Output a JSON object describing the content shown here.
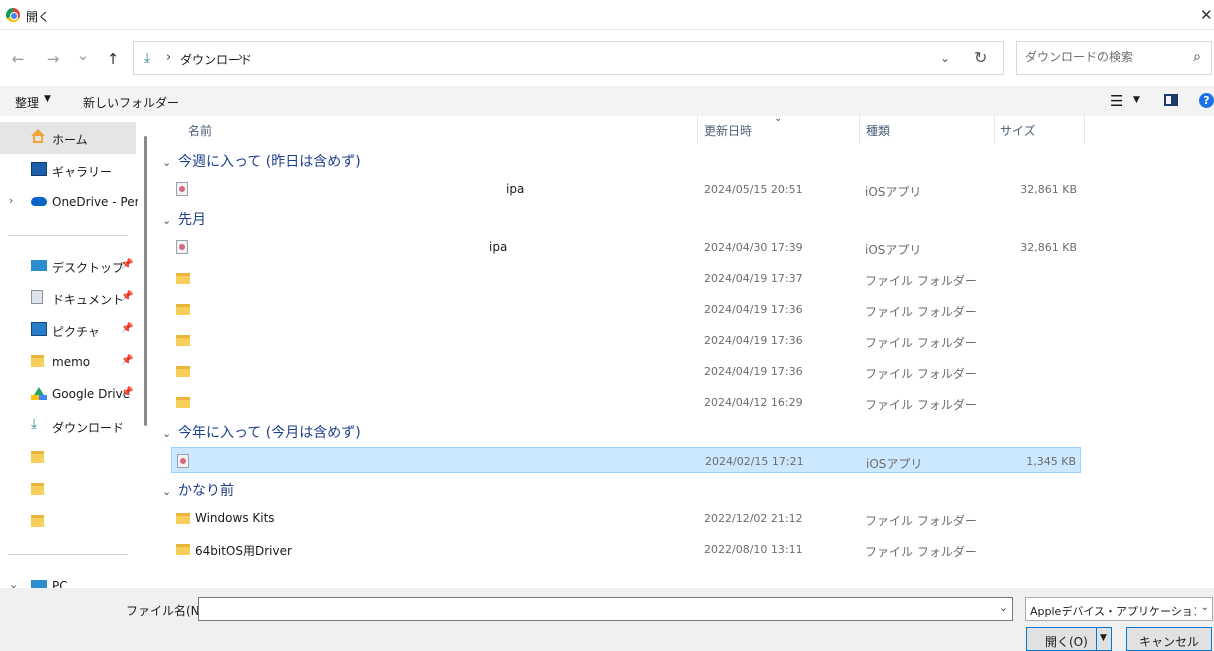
{
  "window": {
    "title": "開く",
    "close_glyph": "✕"
  },
  "nav": {
    "back_glyph": "←",
    "forward_glyph": "→",
    "recent_glyph": "⌄",
    "up_glyph": "↑",
    "address_icon": "download-icon",
    "address_crumb": "ダウンロード",
    "crumb_separator": "›",
    "address_dropdown_glyph": "⌄",
    "refresh_glyph": "↻",
    "search_placeholder": "ダウンロードの検索",
    "search_glyph": "⌕"
  },
  "toolbar": {
    "organize_label": "整理",
    "organize_caret": "▼",
    "new_folder_label": "新しいフォルダー",
    "view_glyph": "☰",
    "view_caret": "▼",
    "help_glyph": "?"
  },
  "sidebar": {
    "items": [
      {
        "label": "ホーム",
        "icon": "home-icon",
        "selected": true,
        "pinned": false,
        "chevron": ""
      },
      {
        "label": "ギャラリー",
        "icon": "gallery-icon",
        "pinned": false,
        "chevron": ""
      },
      {
        "label": "OneDrive - Personal",
        "icon": "onedrive-icon",
        "pinned": false,
        "chevron": "›"
      },
      {
        "label": "デスクトップ",
        "icon": "desktop-icon",
        "pinned": true
      },
      {
        "label": "ドキュメント",
        "icon": "document-icon",
        "pinned": true
      },
      {
        "label": "ピクチャ",
        "icon": "picture-icon",
        "pinned": true
      },
      {
        "label": "memo",
        "icon": "folder-icon",
        "pinned": true
      },
      {
        "label": "Google Drive",
        "icon": "google-drive-icon",
        "pinned": true
      },
      {
        "label": "ダウンロード",
        "icon": "download-icon",
        "pinned": false
      },
      {
        "label": "",
        "icon": "folder-icon"
      },
      {
        "label": "",
        "icon": "folder-icon"
      },
      {
        "label": "",
        "icon": "folder-icon"
      },
      {
        "label": "PC",
        "icon": "pc-icon",
        "chevron": "⌄"
      }
    ],
    "pin_glyph": "📌"
  },
  "columns": {
    "name": "名前",
    "date": "更新日時",
    "type": "種類",
    "size": "サイズ",
    "sort_glyph": "⌄"
  },
  "groups": [
    {
      "label": "今週に入って (昨日は含めず)",
      "chevron": "⌄"
    },
    {
      "label": "先月",
      "chevron": "⌄"
    },
    {
      "label": "今年に入って (今月は含めず)",
      "chevron": "⌄"
    },
    {
      "label": "かなり前",
      "chevron": "⌄"
    }
  ],
  "files": [
    {
      "name": "ipa",
      "date": "2024/05/15 20:51",
      "type": "iOSアプリ",
      "size": "32,861 KB",
      "kind": "file"
    },
    {
      "name": "ipa",
      "date": "2024/04/30 17:39",
      "type": "iOSアプリ",
      "size": "32,861 KB",
      "kind": "file"
    },
    {
      "name": "",
      "date": "2024/04/19 17:37",
      "type": "ファイル フォルダー",
      "size": "",
      "kind": "folder"
    },
    {
      "name": "",
      "date": "2024/04/19 17:36",
      "type": "ファイル フォルダー",
      "size": "",
      "kind": "folder"
    },
    {
      "name": "",
      "date": "2024/04/19 17:36",
      "type": "ファイル フォルダー",
      "size": "",
      "kind": "folder"
    },
    {
      "name": "",
      "date": "2024/04/19 17:36",
      "type": "ファイル フォルダー",
      "size": "",
      "kind": "folder"
    },
    {
      "name": "",
      "date": "2024/04/12 16:29",
      "type": "ファイル フォルダー",
      "size": "",
      "kind": "folder"
    },
    {
      "name": "",
      "date": "2024/02/15 17:21",
      "type": "iOSアプリ",
      "size": "1,345 KB",
      "kind": "file",
      "selected": true
    },
    {
      "name": "Windows Kits",
      "date": "2022/12/02 21:12",
      "type": "ファイル フォルダー",
      "size": "",
      "kind": "folder"
    },
    {
      "name": "64bitOS用Driver",
      "date": "2022/08/10 13:11",
      "type": "ファイル フォルダー",
      "size": "",
      "kind": "folder"
    }
  ],
  "bottom": {
    "filename_label": "ファイル名(N):",
    "filename_value": "",
    "filename_caret": "⌄",
    "filter_value": "Appleデバイス・アプリケーションファイル",
    "filter_caret": "⌄",
    "open_label": "開く(O)",
    "open_split_glyph": "▼",
    "cancel_label": "キャンセル"
  }
}
